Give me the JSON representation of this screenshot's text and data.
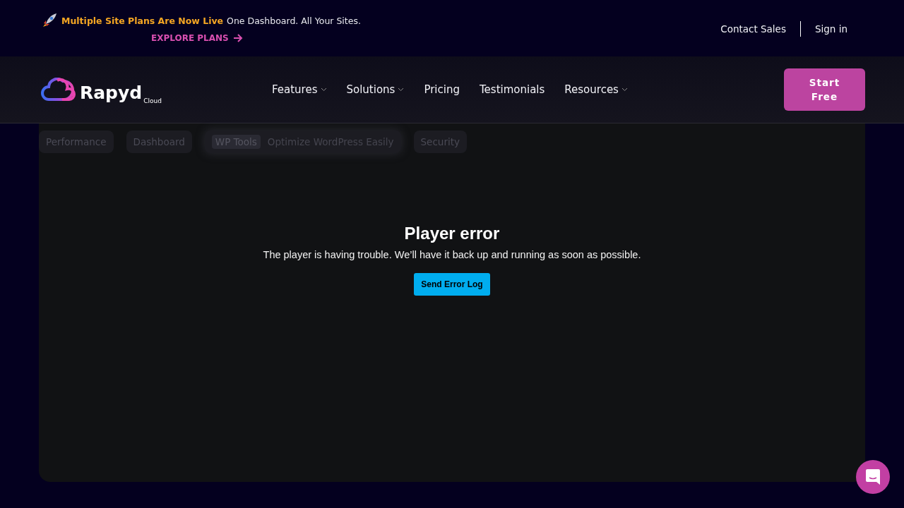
{
  "announcement": {
    "headline": "Multiple Site Plans Are Now Live",
    "tagline": "One Dashboard. All Your Sites.",
    "link": "EXPLORE PLANS"
  },
  "top_links": [
    "Contact Sales",
    "Sign in"
  ],
  "logo": {
    "name": "Rapyd",
    "sub": "Cloud"
  },
  "nav": [
    {
      "label": "Features",
      "dropdown": true
    },
    {
      "label": "Solutions",
      "dropdown": true
    },
    {
      "label": "Pricing",
      "dropdown": false
    },
    {
      "label": "Testimonials",
      "dropdown": false
    },
    {
      "label": "Resources",
      "dropdown": true
    }
  ],
  "cta": "Start Free",
  "video_tabs": [
    {
      "label": "Performance",
      "selected": false
    },
    {
      "label": "Dashboard",
      "selected": false
    },
    {
      "label": "WP Tools",
      "selected": true,
      "description": "Optimize WordPress Easily"
    },
    {
      "label": "Security",
      "selected": false
    }
  ],
  "player": {
    "title": "Player error",
    "message": "The player is having trouble. We’ll have it back up and running as soon as possible.",
    "button": "Send Error Log"
  }
}
